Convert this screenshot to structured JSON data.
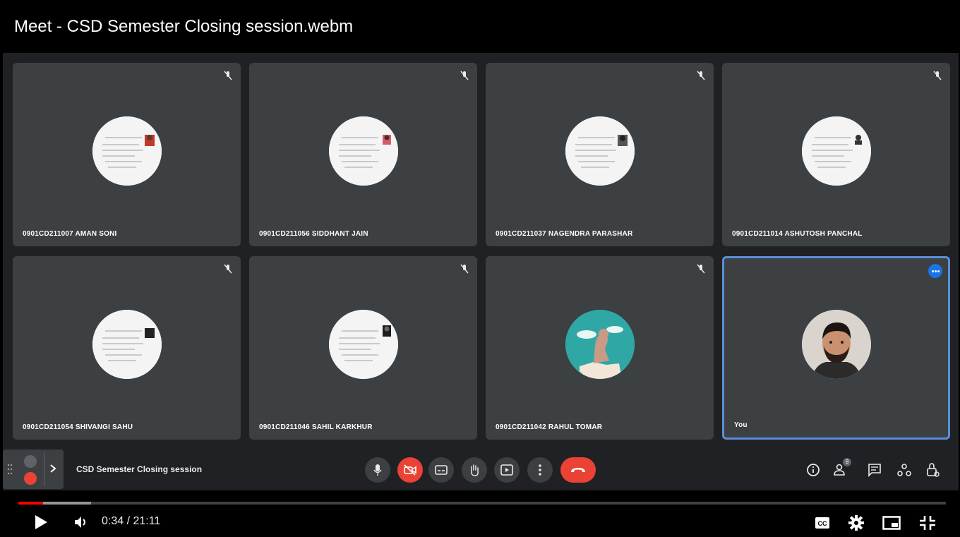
{
  "window": {
    "title": "Meet - CSD Semester Closing session.webm"
  },
  "participants": [
    {
      "name": "0901CD211007 AMAN SONI",
      "muted": true
    },
    {
      "name": "0901CD211056 SIDDHANT JAIN",
      "muted": true
    },
    {
      "name": "0901CD211037 NAGENDRA PARASHAR",
      "muted": true
    },
    {
      "name": "0901CD211014 ASHUTOSH PANCHAL",
      "muted": true
    },
    {
      "name": "0901CD211054 SHIVANGI SAHU",
      "muted": true
    },
    {
      "name": "0901CD211046 SAHIL KARKHUR",
      "muted": true
    },
    {
      "name": "0901CD211042 RAHUL TOMAR",
      "muted": true
    },
    {
      "name": "You",
      "muted": false
    }
  ],
  "meet_controls": {
    "meeting_title": "CSD Semester Closing session",
    "buttons": [
      "mic-icon",
      "camera-off-icon",
      "captions-icon",
      "raise-hand-icon",
      "present-icon",
      "more-options-icon",
      "hang-up-icon"
    ],
    "right_icons": [
      "info-icon",
      "people-icon",
      "chat-icon",
      "activities-icon",
      "host-controls-icon"
    ],
    "people_count": "8"
  },
  "player": {
    "current_time": "0:34",
    "separator": " / ",
    "duration": "21:11",
    "time_display": "0:34 / 21:11",
    "progress_fraction": 0.027,
    "buffered_fraction": 0.078,
    "icons": [
      "play-icon",
      "volume-icon",
      "subtitles-icon",
      "settings-icon",
      "miniplayer-icon",
      "exit-fullscreen-icon"
    ]
  },
  "colors": {
    "tile_bg": "#3c4043",
    "meet_bg": "#202124",
    "accent_blue": "#5a8fd6",
    "hangup_red": "#ea4335",
    "progress_red": "#ff0000"
  }
}
